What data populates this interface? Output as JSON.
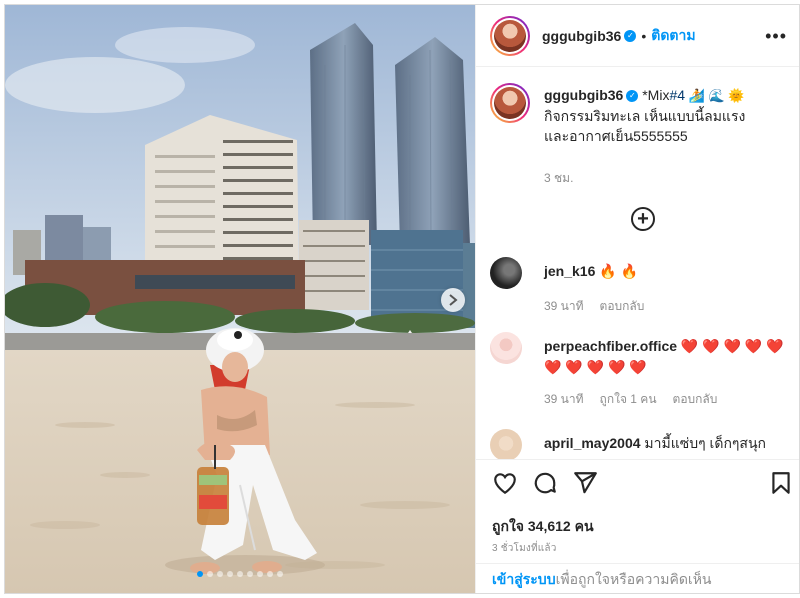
{
  "post": {
    "username": "gggubgib36",
    "follow_label": "ติดตาม",
    "separator": "•",
    "more_label": "•••",
    "caption_prefix": " *Mix",
    "caption_hashtag": "#4",
    "caption_emojis": " 🏄 🌊 🌞",
    "caption_line2": "กิจกรรมริมทะเล เห็นแบบนี้ลมแรง",
    "caption_line3": "และอากาศเย็น5555555",
    "caption_time": "3 ชม.",
    "load_more_label": "+",
    "photo_slide_count": 9,
    "photo_active_slide": 1
  },
  "comments": [
    {
      "username": "jen_k16",
      "text": " 🔥 🔥",
      "time": "39 นาที",
      "likes": "",
      "reply_label": "ตอบกลับ"
    },
    {
      "username": "perpeachfiber.office",
      "text": " ❤️ ❤️ ❤️ ❤️ ❤️ ❤️ ❤️ ❤️ ❤️ ❤️",
      "time": "39 นาที",
      "likes": "ถูกใจ 1 คน",
      "reply_label": "ตอบกลับ"
    },
    {
      "username": "april_may2004",
      "text": " มามี้แซ่บๆ เด็กๆสนุก",
      "time": "",
      "likes": "",
      "reply_label": ""
    }
  ],
  "actions": {
    "like_icon": "heart-outline-icon",
    "comment_icon": "comment-bubble-icon",
    "share_icon": "paper-plane-icon",
    "save_icon": "bookmark-icon"
  },
  "likes_text": "ถูกใจ 34,612 คน",
  "posted_time": "3 ชั่วโมงที่แล้ว",
  "login": {
    "link_label": "เข้าสู่ระบบ",
    "suffix": "เพื่อถูกใจหรือความคิดเห็น"
  },
  "colors": {
    "accent": "#0095f6",
    "heart": "#ed4956",
    "muted": "#8e8e8e"
  }
}
